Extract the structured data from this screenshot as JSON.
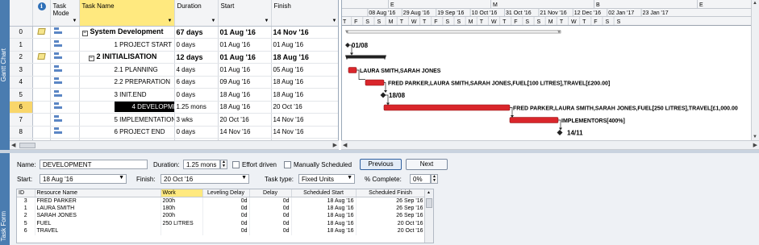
{
  "side_views": {
    "gantt": "Gantt Chart",
    "form": "Task Form"
  },
  "columns": {
    "info_icon": "i",
    "task_mode": "Task Mode",
    "task_name": "Task Name",
    "duration": "Duration",
    "start": "Start",
    "finish": "Finish"
  },
  "tasks": [
    {
      "id": "0",
      "note": true,
      "name": "System Development",
      "duration": "67 days",
      "start": "01 Aug '16",
      "finish": "14 Nov '16",
      "bold": true,
      "collapse": "−"
    },
    {
      "id": "1",
      "note": false,
      "name": "1 PROJECT START",
      "duration": "0 days",
      "start": "01 Aug '16",
      "finish": "01 Aug '16"
    },
    {
      "id": "2",
      "note": true,
      "name": "2 INITIALISATION",
      "duration": "12 days",
      "start": "01 Aug '16",
      "finish": "18 Aug '16",
      "bold": true,
      "collapse": "−"
    },
    {
      "id": "3",
      "note": false,
      "name": "2.1 PLANNING",
      "duration": "4 days",
      "start": "01 Aug '16",
      "finish": "05 Aug '16"
    },
    {
      "id": "4",
      "note": false,
      "name": "2.2 PREPARATION",
      "duration": "6 days",
      "start": "09 Aug '16",
      "finish": "18 Aug '16"
    },
    {
      "id": "5",
      "note": false,
      "name": "3 INIT.END",
      "duration": "0 days",
      "start": "18 Aug '16",
      "finish": "18 Aug '16"
    },
    {
      "id": "6",
      "note": false,
      "name": "4 DEVELOPMENT",
      "duration": "1.25 mons",
      "start": "18 Aug '16",
      "finish": "20 Oct '16",
      "selected": true
    },
    {
      "id": "7",
      "note": false,
      "name": "5 IMPLEMENTATION",
      "duration": "3 wks",
      "start": "20 Oct '16",
      "finish": "14 Nov '16"
    },
    {
      "id": "8",
      "note": false,
      "name": "6 PROJECT END",
      "duration": "0 days",
      "start": "14 Nov '16",
      "finish": "14 Nov '16"
    }
  ],
  "timescale": {
    "top_tier": [
      "E",
      "M",
      "B",
      "E"
    ],
    "middle_tier": [
      "'16",
      "08 Aug '16",
      "29 Aug '16",
      "19 Sep '16",
      "10 Oct '16",
      "31 Oct '16",
      "21 Nov '16",
      "12 Dec '16",
      "02 Jan '17",
      "23 Jan '17"
    ],
    "bottom_tier": [
      "T",
      "F",
      "S",
      "S",
      "M",
      "T",
      "W",
      "T",
      "F",
      "S",
      "S",
      "M",
      "T",
      "W",
      "T",
      "F",
      "S",
      "S",
      "M",
      "T",
      "W",
      "T",
      "F",
      "S",
      "S"
    ]
  },
  "gantt_labels": {
    "task1": "01/08",
    "task3": "LAURA SMITH,SARAH JONES",
    "task4": "FRED PARKER,LAURA SMITH,SARAH JONES,FUEL[100 LITRES],TRAVEL[£200.00]",
    "task5": "18/08",
    "task6": "FRED PARKER,LAURA SMITH,SARAH JONES,FUEL[250 LITRES],TRAVEL[£1,000.00",
    "task7": "IMPLEMENTORS[400%]",
    "task8": "14/11"
  },
  "colors": {
    "bar": "#d9262b",
    "bar_dark": "#8e1417",
    "summary": "#222222",
    "accent": "#ffe97f"
  },
  "form": {
    "name_label": "Name:",
    "name_value": "DEVELOPMENT",
    "duration_label": "Duration:",
    "duration_value": "1.25 mons",
    "effort_driven": "Effort driven",
    "manually_scheduled": "Manually Scheduled",
    "previous": "Previous",
    "next": "Next",
    "start_label": "Start:",
    "start_value": "18 Aug '16",
    "finish_label": "Finish:",
    "finish_value": "20 Oct '16",
    "task_type_label": "Task type:",
    "task_type_value": "Fixed Units",
    "pct_label": "% Complete:",
    "pct_value": "0%"
  },
  "resources": {
    "headers": [
      "ID",
      "Resource Name",
      "Work",
      "Leveling Delay",
      "Delay",
      "Scheduled Start",
      "Scheduled Finish"
    ],
    "rows": [
      [
        "3",
        "FRED PARKER",
        "200h",
        "0d",
        "0d",
        "18 Aug '16",
        "26 Sep '16"
      ],
      [
        "1",
        "LAURA SMITH",
        "180h",
        "0d",
        "0d",
        "18 Aug '16",
        "26 Sep '16"
      ],
      [
        "2",
        "SARAH JONES",
        "200h",
        "0d",
        "0d",
        "18 Aug '16",
        "26 Sep '16"
      ],
      [
        "5",
        "FUEL",
        "250 LITRES",
        "0d",
        "0d",
        "18 Aug '16",
        "20 Oct '16"
      ],
      [
        "6",
        "TRAVEL",
        "",
        "0d",
        "0d",
        "18 Aug '16",
        "20 Oct '16"
      ]
    ]
  }
}
